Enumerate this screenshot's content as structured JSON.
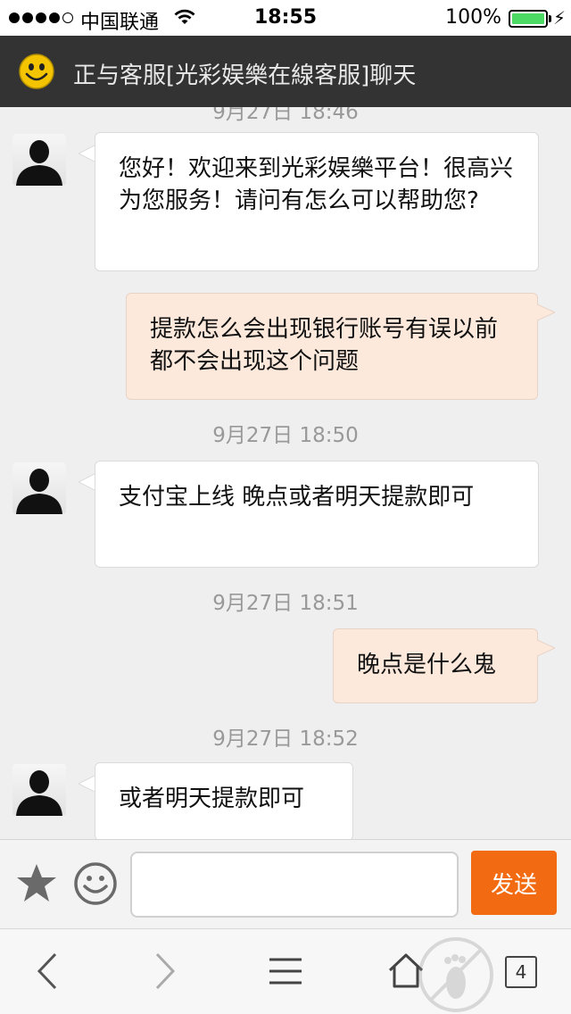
{
  "status_bar": {
    "carrier": "中国联通",
    "time": "18:55",
    "battery": "100%"
  },
  "header": {
    "title": "正与客服[光彩娱樂在線客服]聊天"
  },
  "messages": [
    {
      "type": "timestamp",
      "text": "9月27日 18:46"
    },
    {
      "type": "in",
      "text": "您好！欢迎来到光彩娱樂平台！很高兴为您服务！请问有怎么可以帮助您?"
    },
    {
      "type": "out",
      "text": "提款怎么会出现银行账号有误以前都不会出现这个问题"
    },
    {
      "type": "timestamp",
      "text": "9月27日 18:50"
    },
    {
      "type": "in",
      "text": "支付宝上线 晚点或者明天提款即可"
    },
    {
      "type": "timestamp",
      "text": "9月27日 18:51"
    },
    {
      "type": "out",
      "text": "晚点是什么鬼"
    },
    {
      "type": "timestamp",
      "text": "9月27日 18:52"
    },
    {
      "type": "in",
      "text": "或者明天提款即可"
    }
  ],
  "input": {
    "value": "",
    "send_label": "发送"
  },
  "nav": {
    "tab_count": "4"
  },
  "colors": {
    "header_bg": "#333333",
    "send_button": "#f26b12",
    "outgoing_bubble": "#fde9dc",
    "incoming_bubble": "#ffffff"
  },
  "icons": [
    "signal-dots-icon",
    "wifi-icon",
    "battery-icon",
    "smiley-logo-icon",
    "avatar-icon",
    "star-icon",
    "emoji-icon",
    "back-icon",
    "forward-icon",
    "menu-icon",
    "home-icon",
    "tabs-icon"
  ]
}
